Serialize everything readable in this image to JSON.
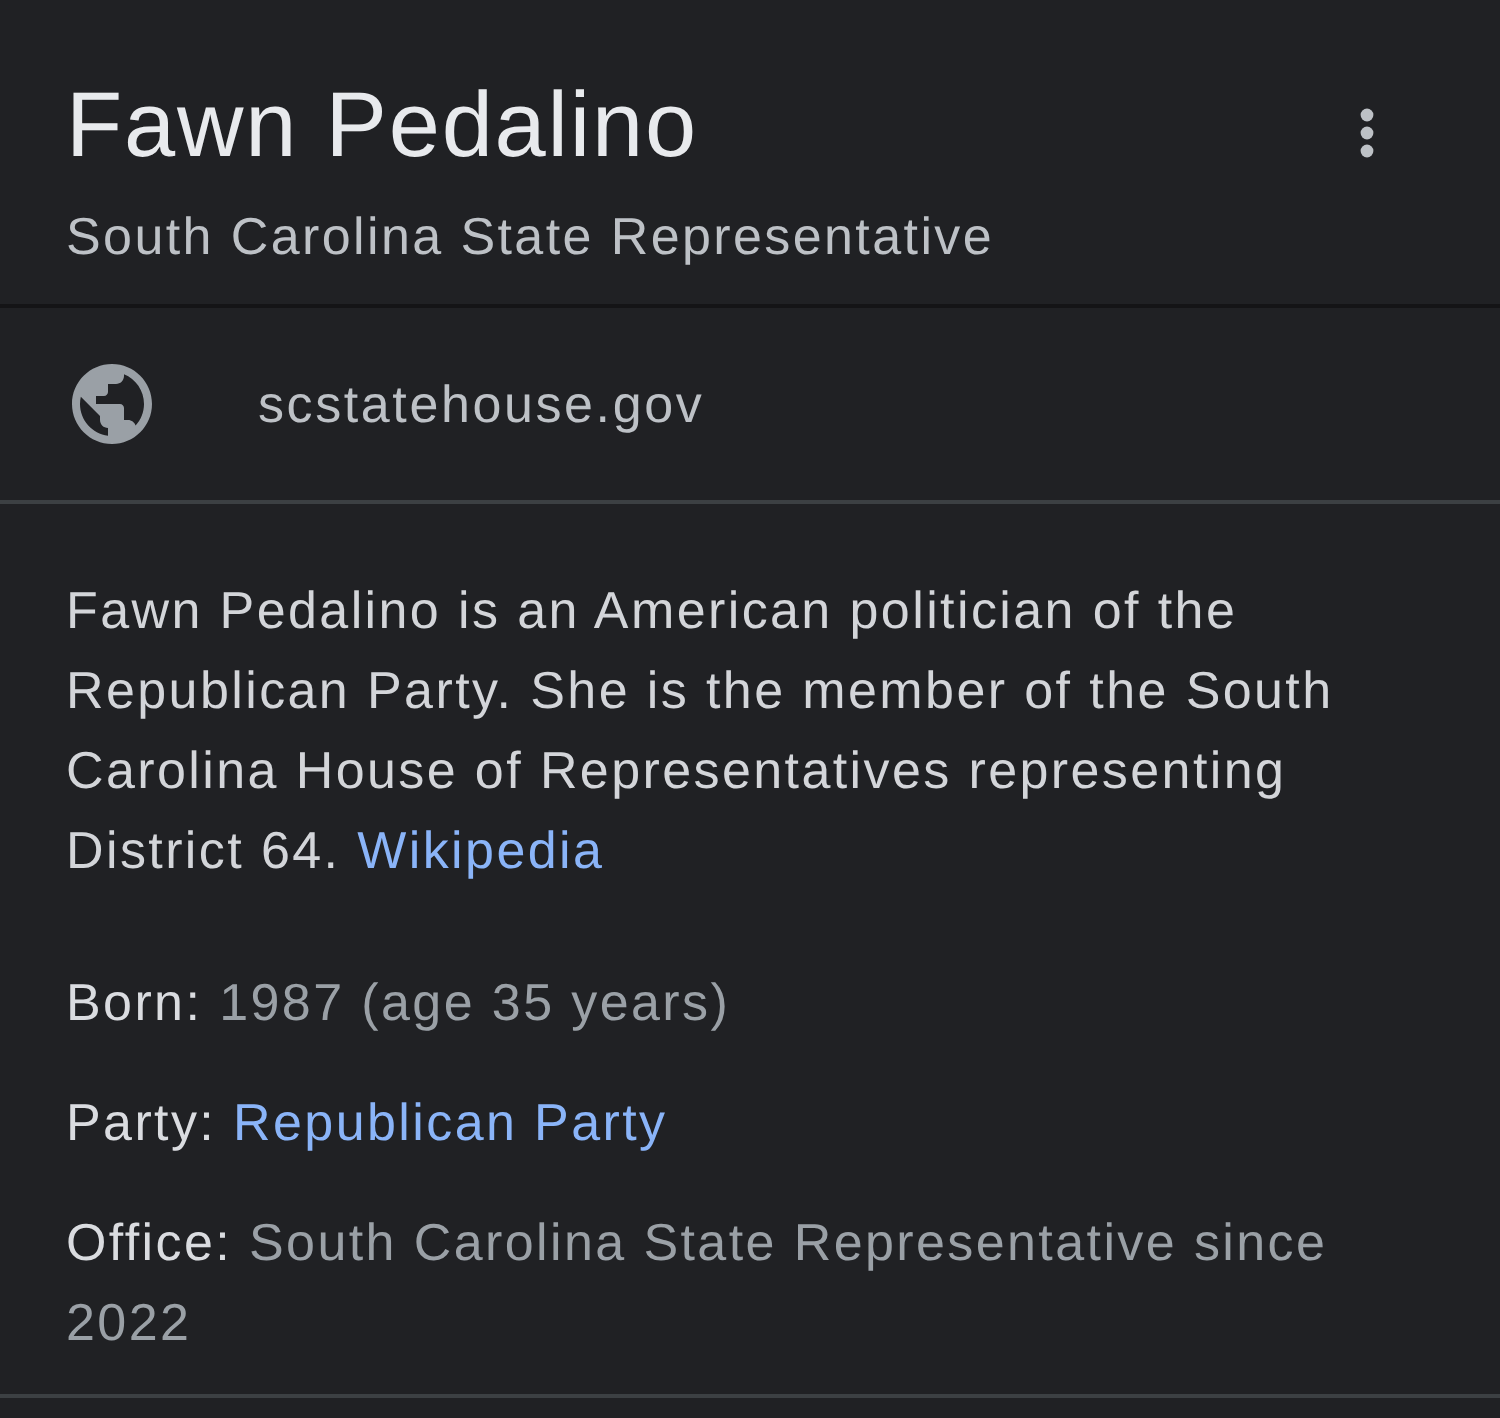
{
  "header": {
    "title": "Fawn Pedalino",
    "subtitle": "South Carolina State Representative"
  },
  "website": {
    "label": "scstatehouse.gov"
  },
  "description": {
    "text": "Fawn Pedalino is an American politician of the Republican Party. She is the member of the South Carolina House of Representatives representing District 64.",
    "link": "Wikipedia"
  },
  "facts": [
    {
      "kind": "text",
      "label": "Born:",
      "value": "1987 (age 35 years)"
    },
    {
      "kind": "link",
      "label": "Party:",
      "value": "Republican Party"
    },
    {
      "kind": "text",
      "label": "Office:",
      "value": "South Carolina State Representative since 2022"
    }
  ]
}
